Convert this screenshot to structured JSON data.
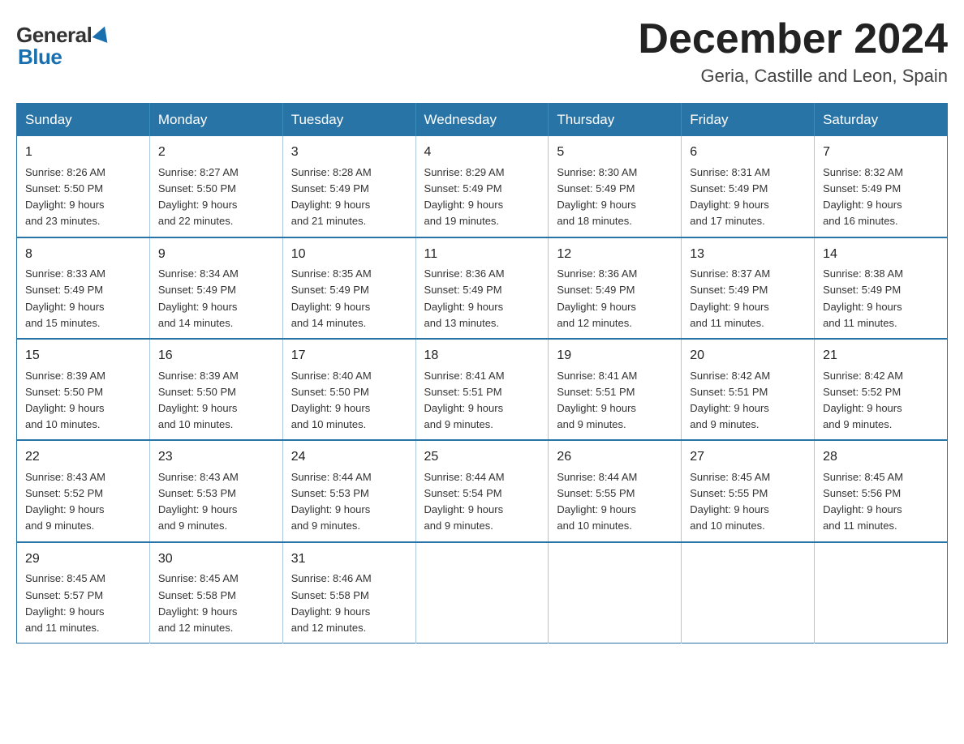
{
  "header": {
    "month_title": "December 2024",
    "location": "Geria, Castille and Leon, Spain"
  },
  "logo": {
    "general": "General",
    "blue": "Blue"
  },
  "days_of_week": [
    "Sunday",
    "Monday",
    "Tuesday",
    "Wednesday",
    "Thursday",
    "Friday",
    "Saturday"
  ],
  "weeks": [
    [
      {
        "day": "1",
        "sunrise": "8:26 AM",
        "sunset": "5:50 PM",
        "daylight": "9 hours and 23 minutes."
      },
      {
        "day": "2",
        "sunrise": "8:27 AM",
        "sunset": "5:50 PM",
        "daylight": "9 hours and 22 minutes."
      },
      {
        "day": "3",
        "sunrise": "8:28 AM",
        "sunset": "5:49 PM",
        "daylight": "9 hours and 21 minutes."
      },
      {
        "day": "4",
        "sunrise": "8:29 AM",
        "sunset": "5:49 PM",
        "daylight": "9 hours and 19 minutes."
      },
      {
        "day": "5",
        "sunrise": "8:30 AM",
        "sunset": "5:49 PM",
        "daylight": "9 hours and 18 minutes."
      },
      {
        "day": "6",
        "sunrise": "8:31 AM",
        "sunset": "5:49 PM",
        "daylight": "9 hours and 17 minutes."
      },
      {
        "day": "7",
        "sunrise": "8:32 AM",
        "sunset": "5:49 PM",
        "daylight": "9 hours and 16 minutes."
      }
    ],
    [
      {
        "day": "8",
        "sunrise": "8:33 AM",
        "sunset": "5:49 PM",
        "daylight": "9 hours and 15 minutes."
      },
      {
        "day": "9",
        "sunrise": "8:34 AM",
        "sunset": "5:49 PM",
        "daylight": "9 hours and 14 minutes."
      },
      {
        "day": "10",
        "sunrise": "8:35 AM",
        "sunset": "5:49 PM",
        "daylight": "9 hours and 14 minutes."
      },
      {
        "day": "11",
        "sunrise": "8:36 AM",
        "sunset": "5:49 PM",
        "daylight": "9 hours and 13 minutes."
      },
      {
        "day": "12",
        "sunrise": "8:36 AM",
        "sunset": "5:49 PM",
        "daylight": "9 hours and 12 minutes."
      },
      {
        "day": "13",
        "sunrise": "8:37 AM",
        "sunset": "5:49 PM",
        "daylight": "9 hours and 11 minutes."
      },
      {
        "day": "14",
        "sunrise": "8:38 AM",
        "sunset": "5:49 PM",
        "daylight": "9 hours and 11 minutes."
      }
    ],
    [
      {
        "day": "15",
        "sunrise": "8:39 AM",
        "sunset": "5:50 PM",
        "daylight": "9 hours and 10 minutes."
      },
      {
        "day": "16",
        "sunrise": "8:39 AM",
        "sunset": "5:50 PM",
        "daylight": "9 hours and 10 minutes."
      },
      {
        "day": "17",
        "sunrise": "8:40 AM",
        "sunset": "5:50 PM",
        "daylight": "9 hours and 10 minutes."
      },
      {
        "day": "18",
        "sunrise": "8:41 AM",
        "sunset": "5:51 PM",
        "daylight": "9 hours and 9 minutes."
      },
      {
        "day": "19",
        "sunrise": "8:41 AM",
        "sunset": "5:51 PM",
        "daylight": "9 hours and 9 minutes."
      },
      {
        "day": "20",
        "sunrise": "8:42 AM",
        "sunset": "5:51 PM",
        "daylight": "9 hours and 9 minutes."
      },
      {
        "day": "21",
        "sunrise": "8:42 AM",
        "sunset": "5:52 PM",
        "daylight": "9 hours and 9 minutes."
      }
    ],
    [
      {
        "day": "22",
        "sunrise": "8:43 AM",
        "sunset": "5:52 PM",
        "daylight": "9 hours and 9 minutes."
      },
      {
        "day": "23",
        "sunrise": "8:43 AM",
        "sunset": "5:53 PM",
        "daylight": "9 hours and 9 minutes."
      },
      {
        "day": "24",
        "sunrise": "8:44 AM",
        "sunset": "5:53 PM",
        "daylight": "9 hours and 9 minutes."
      },
      {
        "day": "25",
        "sunrise": "8:44 AM",
        "sunset": "5:54 PM",
        "daylight": "9 hours and 9 minutes."
      },
      {
        "day": "26",
        "sunrise": "8:44 AM",
        "sunset": "5:55 PM",
        "daylight": "9 hours and 10 minutes."
      },
      {
        "day": "27",
        "sunrise": "8:45 AM",
        "sunset": "5:55 PM",
        "daylight": "9 hours and 10 minutes."
      },
      {
        "day": "28",
        "sunrise": "8:45 AM",
        "sunset": "5:56 PM",
        "daylight": "9 hours and 11 minutes."
      }
    ],
    [
      {
        "day": "29",
        "sunrise": "8:45 AM",
        "sunset": "5:57 PM",
        "daylight": "9 hours and 11 minutes."
      },
      {
        "day": "30",
        "sunrise": "8:45 AM",
        "sunset": "5:58 PM",
        "daylight": "9 hours and 12 minutes."
      },
      {
        "day": "31",
        "sunrise": "8:46 AM",
        "sunset": "5:58 PM",
        "daylight": "9 hours and 12 minutes."
      },
      null,
      null,
      null,
      null
    ]
  ],
  "labels": {
    "sunrise": "Sunrise:",
    "sunset": "Sunset:",
    "daylight": "Daylight:"
  }
}
